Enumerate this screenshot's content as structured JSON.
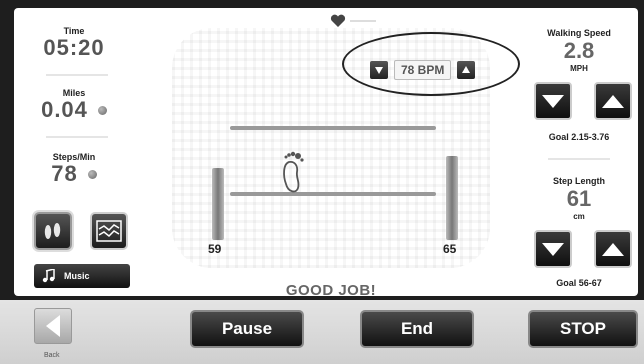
{
  "left": {
    "time": {
      "label": "Time",
      "value": "05:20"
    },
    "miles": {
      "label": "Miles",
      "value": "0.04"
    },
    "steps": {
      "label": "Steps/Min",
      "value": "78"
    },
    "music_label": "Music"
  },
  "center": {
    "heart_rate": "78 BPM",
    "left_post_value": "59",
    "right_post_value": "65",
    "message": "GOOD JOB!"
  },
  "right": {
    "speed": {
      "label": "Walking Speed",
      "value": "2.8",
      "unit": "MPH",
      "goal": "Goal 2.15-3.76"
    },
    "step_length": {
      "label": "Step Length",
      "value": "61",
      "unit": "cm",
      "goal": "Goal 56-67"
    }
  },
  "bottom": {
    "back_label": "Back",
    "pause_label": "Pause",
    "end_label": "End",
    "stop_label": "STOP"
  },
  "icons": {
    "heart": "heart-icon",
    "footprint": "footprint-icon",
    "feet_mode": "feet-icon",
    "graph_mode": "graph-icon",
    "music_note": "music-note-icon",
    "hr_down": "hr-down-icon",
    "hr_up": "hr-up-icon"
  }
}
